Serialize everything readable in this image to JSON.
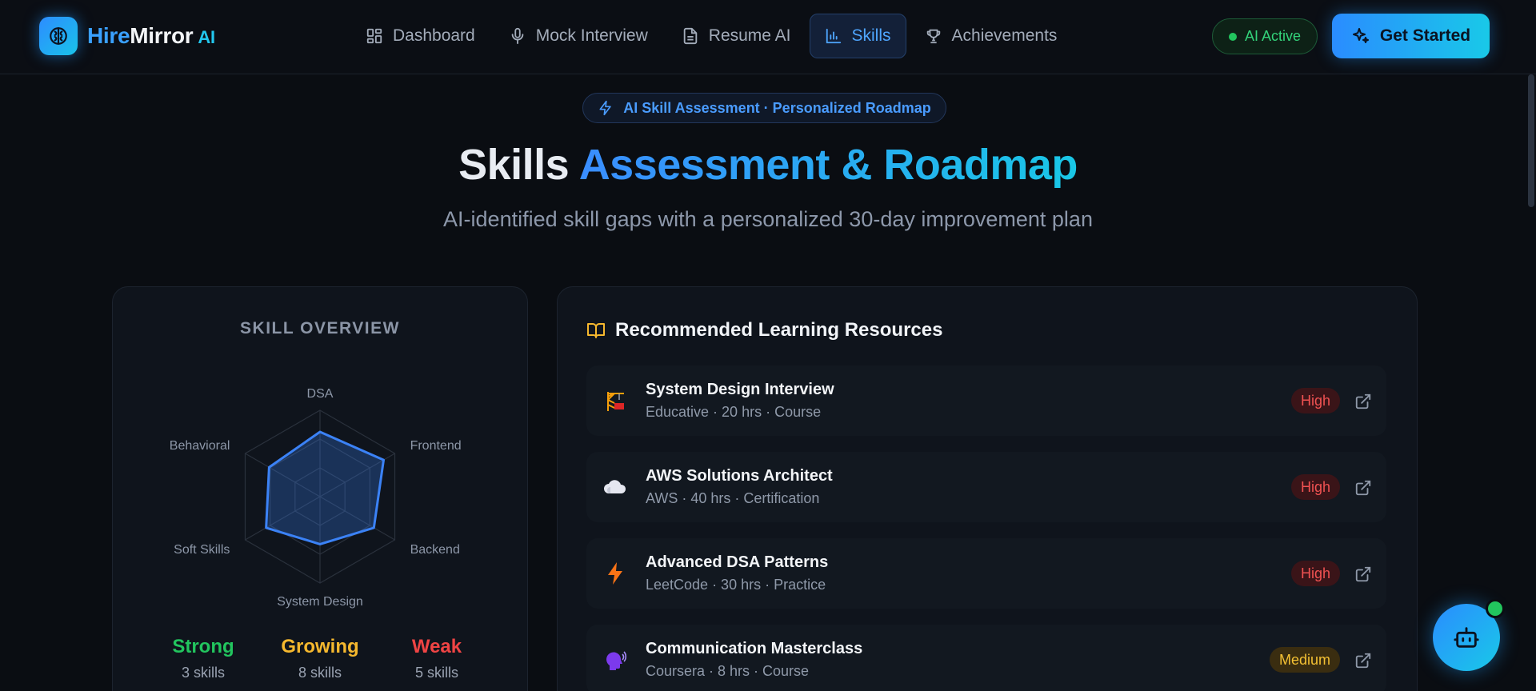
{
  "brand": {
    "hire": "Hire",
    "mirror": "Mirror",
    "ai": "AI",
    "icon": "brain-icon"
  },
  "nav": {
    "items": [
      {
        "label": "Dashboard",
        "icon": "dashboard-grid-icon",
        "active": false
      },
      {
        "label": "Mock Interview",
        "icon": "microphone-icon",
        "active": false
      },
      {
        "label": "Resume AI",
        "icon": "document-icon",
        "active": false
      },
      {
        "label": "Skills",
        "icon": "bar-chart-icon",
        "active": true
      },
      {
        "label": "Achievements",
        "icon": "trophy-icon",
        "active": false
      }
    ],
    "status": "AI Active",
    "cta": "Get Started"
  },
  "hero": {
    "pill": "AI Skill Assessment · Personalized Roadmap",
    "title_plain": "Skills ",
    "title_gradient": "Assessment & Roadmap",
    "subtitle": "AI-identified skill gaps with a personalized 30-day improvement plan"
  },
  "skill_overview": {
    "title": "SKILL OVERVIEW",
    "axes": [
      "DSA",
      "Frontend",
      "Backend",
      "System Design",
      "Soft Skills",
      "Behavioral"
    ],
    "levels": [
      0.75,
      0.85,
      0.72,
      0.55,
      0.72,
      0.68
    ],
    "stats": [
      {
        "label": "Strong",
        "count": "3 skills",
        "color": "#22c55e"
      },
      {
        "label": "Growing",
        "count": "8 skills",
        "color": "#f5b82e"
      },
      {
        "label": "Weak",
        "count": "5 skills",
        "color": "#ef4444"
      }
    ]
  },
  "resources": {
    "title": "Recommended Learning Resources",
    "items": [
      {
        "name": "System Design Interview",
        "meta": "Educative · 20 hrs · Course",
        "priority": "High",
        "icon": "construction-crane-icon"
      },
      {
        "name": "AWS Solutions Architect",
        "meta": "AWS · 40 hrs · Certification",
        "priority": "High",
        "icon": "cloud-icon"
      },
      {
        "name": "Advanced DSA Patterns",
        "meta": "LeetCode · 30 hrs · Practice",
        "priority": "High",
        "icon": "lightning-icon"
      },
      {
        "name": "Communication Masterclass",
        "meta": "Coursera · 8 hrs · Course",
        "priority": "Medium",
        "icon": "speaking-head-icon"
      }
    ]
  }
}
